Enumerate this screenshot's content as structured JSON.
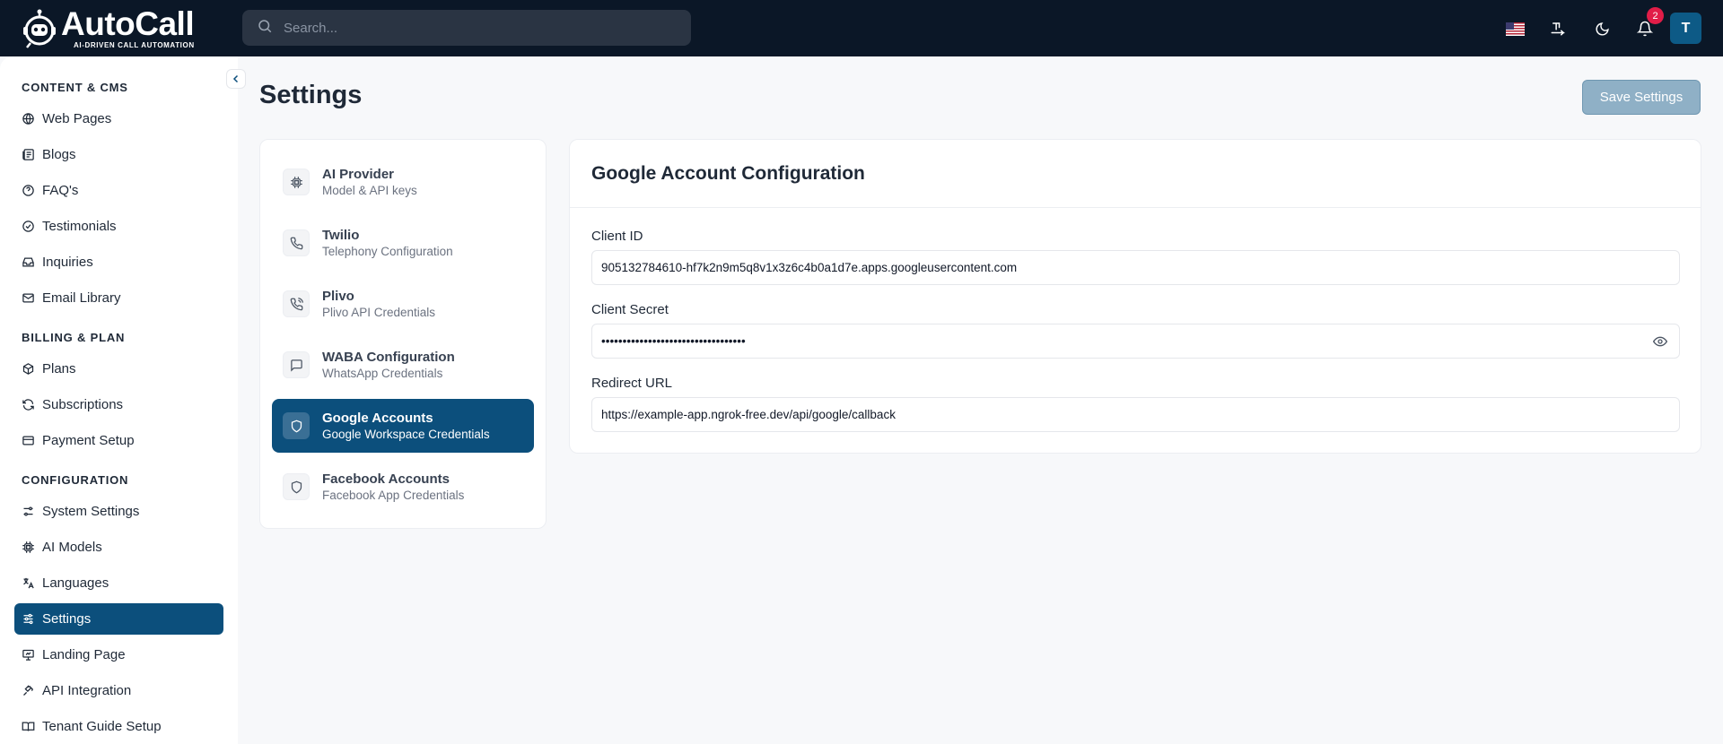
{
  "header": {
    "logo_name_a": "Auto",
    "logo_name_b": "Call",
    "logo_tagline": "AI-DRIVEN CALL AUTOMATION",
    "search_placeholder": "Search...",
    "notification_count": "2",
    "avatar_initial": "T"
  },
  "sidebar": {
    "sections": [
      {
        "title": "CONTENT & CMS",
        "items": [
          {
            "label": "Web Pages",
            "icon": "globe-icon"
          },
          {
            "label": "Blogs",
            "icon": "newspaper-icon"
          },
          {
            "label": "FAQ's",
            "icon": "help-circle-icon"
          },
          {
            "label": "Testimonials",
            "icon": "check-circle-icon"
          },
          {
            "label": "Inquiries",
            "icon": "inbox-icon"
          },
          {
            "label": "Email Library",
            "icon": "mail-icon"
          }
        ]
      },
      {
        "title": "BILLING & PLAN",
        "items": [
          {
            "label": "Plans",
            "icon": "package-icon"
          },
          {
            "label": "Subscriptions",
            "icon": "refresh-icon"
          },
          {
            "label": "Payment Setup",
            "icon": "credit-card-icon"
          }
        ]
      },
      {
        "title": "CONFIGURATION",
        "items": [
          {
            "label": "System Settings",
            "icon": "sliders-icon"
          },
          {
            "label": "AI Models",
            "icon": "cpu-icon"
          },
          {
            "label": "Languages",
            "icon": "languages-icon"
          },
          {
            "label": "Settings",
            "icon": "settings-sliders-icon",
            "active": true
          },
          {
            "label": "Landing Page",
            "icon": "presentation-icon"
          },
          {
            "label": "API Integration",
            "icon": "plug-icon"
          },
          {
            "label": "Tenant Guide Setup",
            "icon": "book-open-icon"
          }
        ]
      }
    ]
  },
  "page": {
    "title": "Settings",
    "save_label": "Save Settings"
  },
  "tabs": [
    {
      "title": "AI Provider",
      "subtitle": "Model & API keys",
      "icon": "cpu-icon"
    },
    {
      "title": "Twilio",
      "subtitle": "Telephony Configuration",
      "icon": "phone-icon"
    },
    {
      "title": "Plivo",
      "subtitle": "Plivo API Credentials",
      "icon": "phone-call-icon"
    },
    {
      "title": "WABA Configuration",
      "subtitle": "WhatsApp Credentials",
      "icon": "message-square-icon"
    },
    {
      "title": "Google Accounts",
      "subtitle": "Google Workspace Credentials",
      "icon": "shield-icon",
      "active": true
    },
    {
      "title": "Facebook Accounts",
      "subtitle": "Facebook App Credentials",
      "icon": "shield-icon"
    }
  ],
  "config": {
    "title": "Google Account Configuration",
    "client_id_label": "Client ID",
    "client_id_value": "905132784610-hf7k2n9m5q8v1x3z6c4b0a1d7e.apps.googleusercontent.com",
    "client_secret_label": "Client Secret",
    "client_secret_value": "••••••••••••••••••••••••••••••••••",
    "redirect_label": "Redirect URL",
    "redirect_value": "https://example-app.ngrok-free.dev/api/google/callback"
  },
  "colors": {
    "topbar": "#0b1727",
    "accent": "#0c4f7c",
    "badge": "#e11d48"
  }
}
